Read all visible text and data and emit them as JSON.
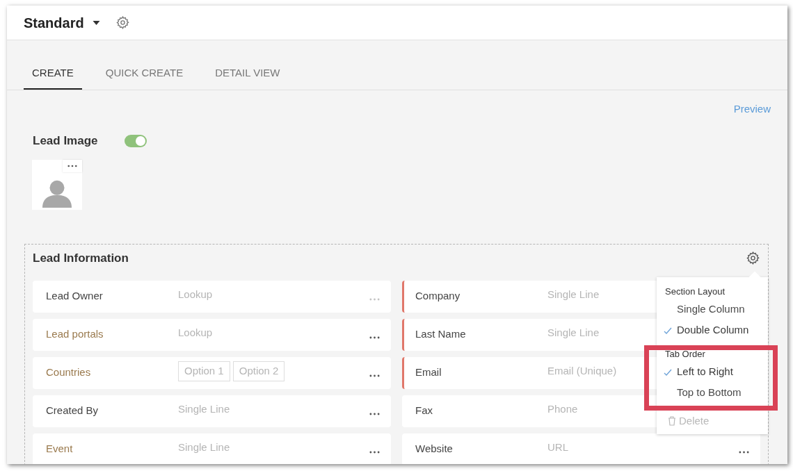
{
  "header": {
    "layout_name": "Standard"
  },
  "tabs": [
    {
      "label": "CREATE",
      "selected": true
    },
    {
      "label": "QUICK CREATE",
      "selected": false
    },
    {
      "label": "DETAIL VIEW",
      "selected": false
    }
  ],
  "preview_link": "Preview",
  "lead_image": {
    "label": "Lead Image",
    "on": true
  },
  "section": {
    "title": "Lead Information",
    "left_fields": [
      {
        "label": "Lead Owner",
        "type": "Lookup",
        "custom": false,
        "mandatory": false,
        "more_disabled": true
      },
      {
        "label": "Lead portals",
        "type": "Lookup",
        "custom": true,
        "mandatory": false,
        "more_disabled": false
      },
      {
        "label": "Countries",
        "options": [
          "Option 1",
          "Option 2"
        ],
        "custom": true,
        "mandatory": false,
        "more_disabled": false
      },
      {
        "label": "Created By",
        "type": "Single Line",
        "custom": false,
        "mandatory": false,
        "more_disabled": false
      },
      {
        "label": "Event",
        "type": "Single Line",
        "custom": true,
        "mandatory": false,
        "more_disabled": false
      }
    ],
    "right_fields": [
      {
        "label": "Company",
        "type": "Single Line",
        "custom": false,
        "mandatory": true
      },
      {
        "label": "Last Name",
        "type": "Single Line",
        "custom": false,
        "mandatory": true
      },
      {
        "label": "Email",
        "type": "Email (Unique)",
        "custom": false,
        "mandatory": true
      },
      {
        "label": "Fax",
        "type": "Phone",
        "custom": false,
        "mandatory": false
      },
      {
        "label": "Website",
        "type": "URL",
        "custom": false,
        "mandatory": false,
        "more_disabled": false
      }
    ]
  },
  "menu": {
    "groups": [
      {
        "heading": "Section Layout",
        "highlighted": false,
        "items": [
          {
            "label": "Single Column",
            "selected": false
          },
          {
            "label": "Double Column",
            "selected": true
          }
        ]
      },
      {
        "heading": "Tab Order",
        "highlighted": true,
        "items": [
          {
            "label": "Left to Right",
            "selected": true
          },
          {
            "label": "Top to Bottom",
            "selected": false
          }
        ]
      }
    ],
    "delete": {
      "label": "Delete",
      "disabled": true
    }
  }
}
